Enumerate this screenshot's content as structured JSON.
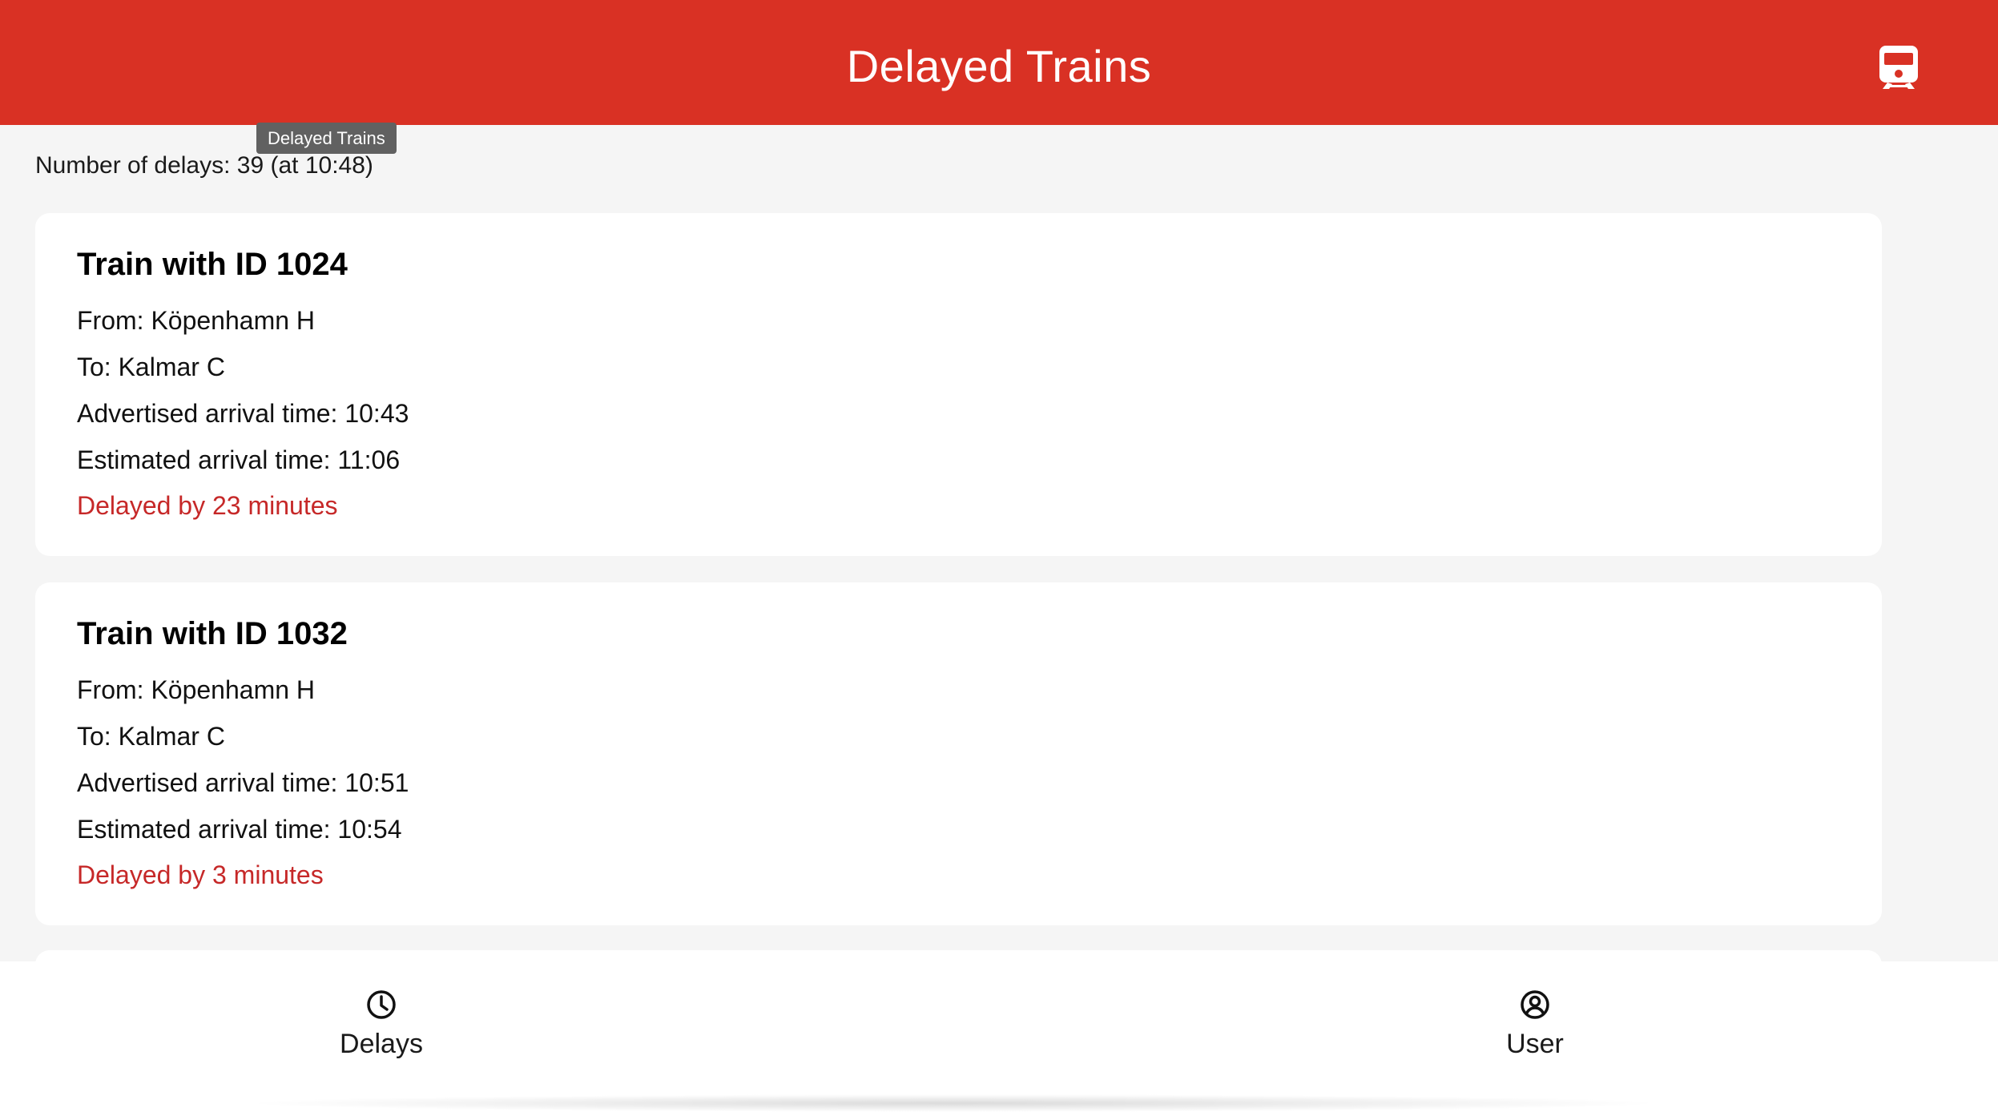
{
  "header": {
    "title": "Delayed Trains",
    "icon": "train-icon",
    "background_color": "#d93124"
  },
  "tooltip": {
    "text": "Delayed Trains"
  },
  "summary": {
    "text": "Number of delays: 39 (at 10:48)"
  },
  "cards": [
    {
      "title": "Train with ID 1024",
      "from": "From: Köpenhamn H",
      "to": "To: Kalmar C",
      "advertised": "Advertised arrival time: 10:43",
      "estimated": "Estimated arrival time: 11:06",
      "delay": "Delayed by 23 minutes"
    },
    {
      "title": "Train with ID 1032",
      "from": "From: Köpenhamn H",
      "to": "To: Kalmar C",
      "advertised": "Advertised arrival time: 10:51",
      "estimated": "Estimated arrival time: 10:54",
      "delay": "Delayed by 3 minutes"
    }
  ],
  "bottom_nav": {
    "items": [
      {
        "label": "Delays",
        "icon": "clock-icon"
      },
      {
        "label": "User",
        "icon": "user-circle-icon"
      }
    ]
  },
  "colors": {
    "accent": "#d93124",
    "delay_text": "#c62828",
    "background": "#f5f5f5"
  }
}
